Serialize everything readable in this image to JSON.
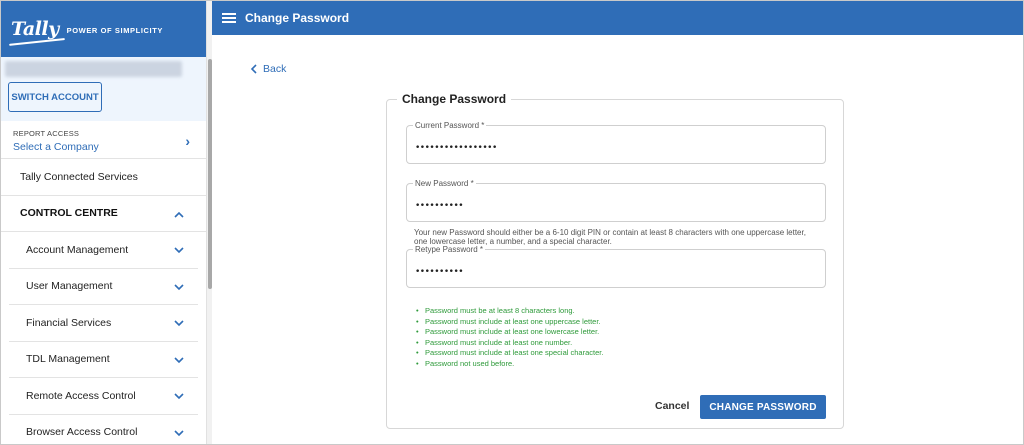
{
  "brand": {
    "logo": "Tally",
    "tagline": "POWER OF SIMPLICITY"
  },
  "account": {
    "switch_label": "SWITCH ACCOUNT"
  },
  "report_access": {
    "title": "REPORT ACCESS",
    "value": "Select a Company"
  },
  "sidebar": {
    "connected": "Tally Connected Services",
    "section": "CONTROL CENTRE",
    "items": [
      {
        "label": "Account Management"
      },
      {
        "label": "User Management"
      },
      {
        "label": "Financial Services"
      },
      {
        "label": "TDL Management"
      },
      {
        "label": "Remote Access Control"
      },
      {
        "label": "Browser Access Control"
      }
    ]
  },
  "header": {
    "title": "Change Password"
  },
  "back_label": "Back",
  "form": {
    "title": "Change Password",
    "current": {
      "label": "Current Password *",
      "value": "•••••••••••••••••"
    },
    "new": {
      "label": "New Password *",
      "value": "••••••••••"
    },
    "helper": "Your new Password should either be a 6-10 digit PIN or contain at least 8 characters with one uppercase letter, one lowercase letter, a number, and a special character.",
    "retype": {
      "label": "Retype Password *",
      "value": "••••••••••"
    },
    "rules": [
      "Password must be at least 8 characters long.",
      "Password must include at least one uppercase letter.",
      "Password must include at least one lowercase letter.",
      "Password must include at least one number.",
      "Password must include at least one special character.",
      "Password not used before."
    ],
    "cancel_label": "Cancel",
    "submit_label": "CHANGE PASSWORD"
  },
  "colors": {
    "brand_blue": "#2f6db7",
    "success_green": "#2e9a3a",
    "account_bg": "#eef5fd"
  }
}
